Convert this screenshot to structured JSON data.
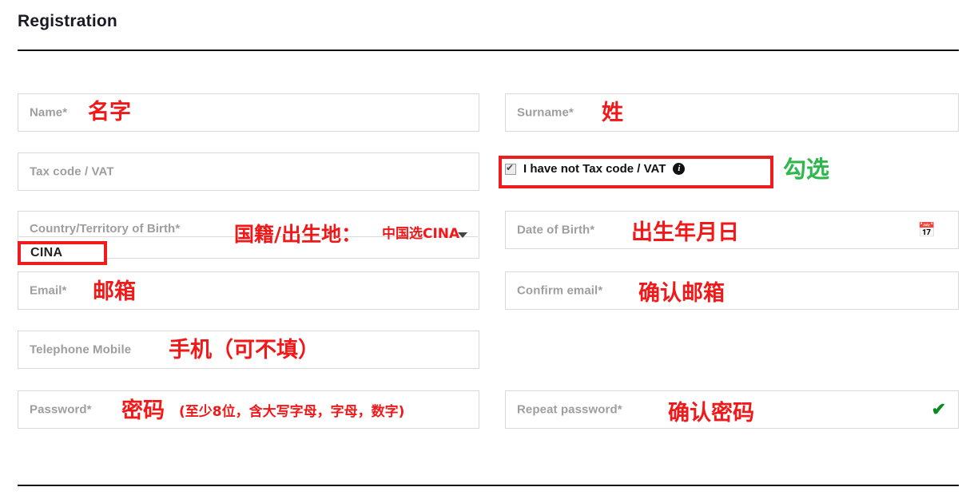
{
  "page": {
    "title": "Registration"
  },
  "form": {
    "fields": {
      "name": {
        "label": "Name*"
      },
      "surname": {
        "label": "Surname*"
      },
      "tax_code": {
        "label": "Tax code / VAT"
      },
      "country": {
        "label": "Country/Territory of Birth*",
        "value": "CINA"
      },
      "date_of_birth": {
        "label": "Date of Birth*",
        "icon": "calendar-icon",
        "icon_glyph": "📅"
      },
      "email": {
        "label": "Email*"
      },
      "confirm_email": {
        "label": "Confirm email*"
      },
      "telephone": {
        "label": "Telephone Mobile"
      },
      "password": {
        "label": "Password*"
      },
      "repeat_password": {
        "label": "Repeat password*",
        "valid_icon": "check-icon",
        "valid_glyph": "✔"
      }
    },
    "checkbox": {
      "label": "I have not Tax code / VAT",
      "checked": true,
      "info_icon": "info-icon",
      "info_glyph": "i"
    }
  },
  "annotations": {
    "colors": {
      "red": "#f01818",
      "green": "#2eb84c",
      "box_red": "#ee1c1c",
      "check_green": "#0a8a21"
    },
    "name": "名字",
    "surname": "姓",
    "checkbox_action": "勾选",
    "country": "国籍/出生地：",
    "country_note": "中国选CINA",
    "country_value_box": "CINA",
    "date_of_birth": "出生年月日",
    "email": "邮箱",
    "confirm_email": "确认邮箱",
    "telephone": "手机（可不填）",
    "password": "密码",
    "password_note": "(至少8位，含大写字母，字母，数字)",
    "repeat_password": "确认密码"
  }
}
